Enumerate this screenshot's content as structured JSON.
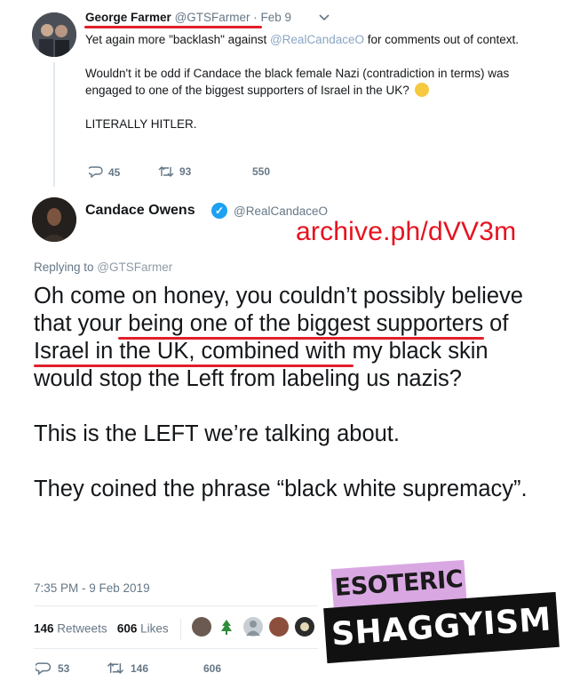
{
  "quoted_tweet": {
    "name": "George Farmer",
    "handle": "@GTSFarmer",
    "date": "· Feb 9",
    "paragraph1_pre": "Yet again more \"backlash\" against ",
    "paragraph1_mention": "@RealCandaceO",
    "paragraph1_post": " for comments out of context.",
    "paragraph2": "Wouldn't it be odd if Candace the black female Nazi (contradiction in terms) was engaged to one of the biggest supporters of Israel in the UK?",
    "paragraph3": "LITERALLY HITLER.",
    "replies": "45",
    "retweets": "93",
    "likes": "550"
  },
  "main_tweet": {
    "name": "Candace Owens",
    "handle": "@RealCandaceO",
    "replying_label": "Replying to ",
    "replying_handle": "@GTSFarmer",
    "line1": "Oh come on honey, you couldn’t possibly believe that your being one of the biggest supporters of Israel in the UK, combined with my black skin would stop the Left from labeling us nazis?",
    "line2": "This is the LEFT we’re talking about.",
    "line3": "They coined the phrase “black white supremacy”.",
    "timestamp": "7:35 PM - 9 Feb 2019",
    "retweet_count": "146",
    "retweet_label": "Retweets",
    "like_count": "606",
    "like_label": "Likes",
    "replies": "53",
    "retweets": "146",
    "likes": "606"
  },
  "annotation": {
    "archive": "archive.ph/dVV3m"
  },
  "watermark": {
    "top": "ESOTERIC",
    "bottom": "SHAGGYISM"
  },
  "colors": {
    "highlight": "#e0202a",
    "archive_text": "#e6121f",
    "verified": "#1da1f2",
    "watermark_pink": "#d9a8e2"
  },
  "icons": [
    "reply-icon",
    "retweet-icon",
    "heart-icon",
    "chevron-down-icon",
    "verified-icon",
    "thinking-emoji-icon"
  ]
}
